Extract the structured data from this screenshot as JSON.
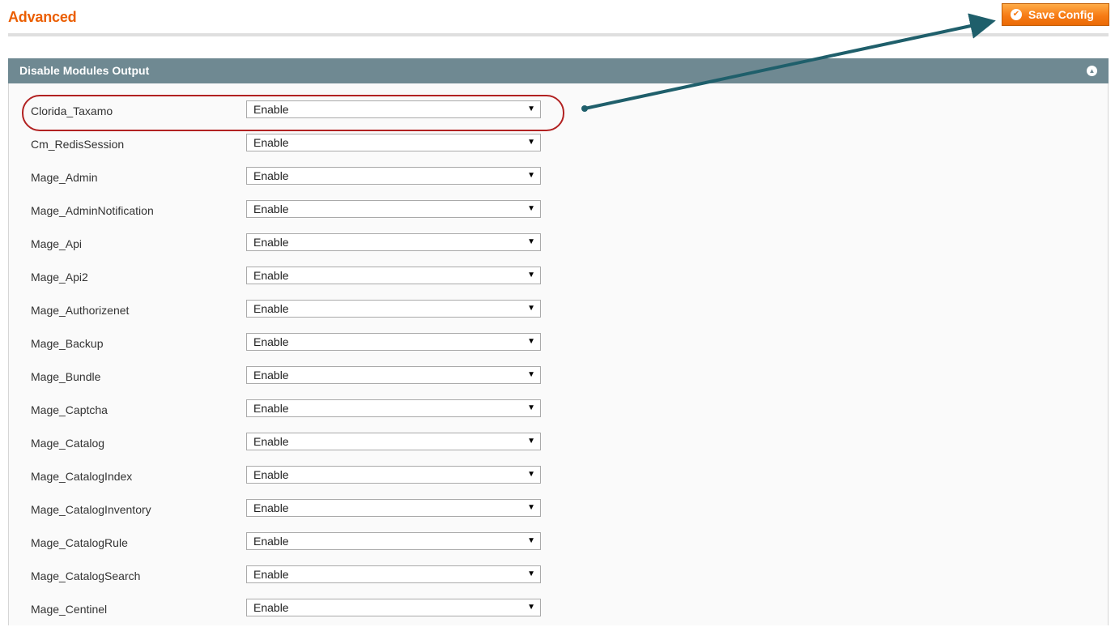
{
  "header": {
    "title": "Advanced",
    "save_label": "Save Config"
  },
  "fieldset": {
    "title": "Disable Modules Output"
  },
  "modules": [
    {
      "name": "Clorida_Taxamo",
      "value": "Enable"
    },
    {
      "name": "Cm_RedisSession",
      "value": "Enable"
    },
    {
      "name": "Mage_Admin",
      "value": "Enable"
    },
    {
      "name": "Mage_AdminNotification",
      "value": "Enable"
    },
    {
      "name": "Mage_Api",
      "value": "Enable"
    },
    {
      "name": "Mage_Api2",
      "value": "Enable"
    },
    {
      "name": "Mage_Authorizenet",
      "value": "Enable"
    },
    {
      "name": "Mage_Backup",
      "value": "Enable"
    },
    {
      "name": "Mage_Bundle",
      "value": "Enable"
    },
    {
      "name": "Mage_Captcha",
      "value": "Enable"
    },
    {
      "name": "Mage_Catalog",
      "value": "Enable"
    },
    {
      "name": "Mage_CatalogIndex",
      "value": "Enable"
    },
    {
      "name": "Mage_CatalogInventory",
      "value": "Enable"
    },
    {
      "name": "Mage_CatalogRule",
      "value": "Enable"
    },
    {
      "name": "Mage_CatalogSearch",
      "value": "Enable"
    },
    {
      "name": "Mage_Centinel",
      "value": "Enable"
    }
  ],
  "icons": {
    "save": "check-circle-icon",
    "collapse": "collapse-up-icon",
    "select_caret": "caret-down-icon"
  },
  "colors": {
    "title": "#eb5e00",
    "save_button": "#f77c16",
    "fieldset_header": "#6f8992",
    "annotation_arrow": "#1f5f6b",
    "annotation_ring": "#b22222"
  }
}
